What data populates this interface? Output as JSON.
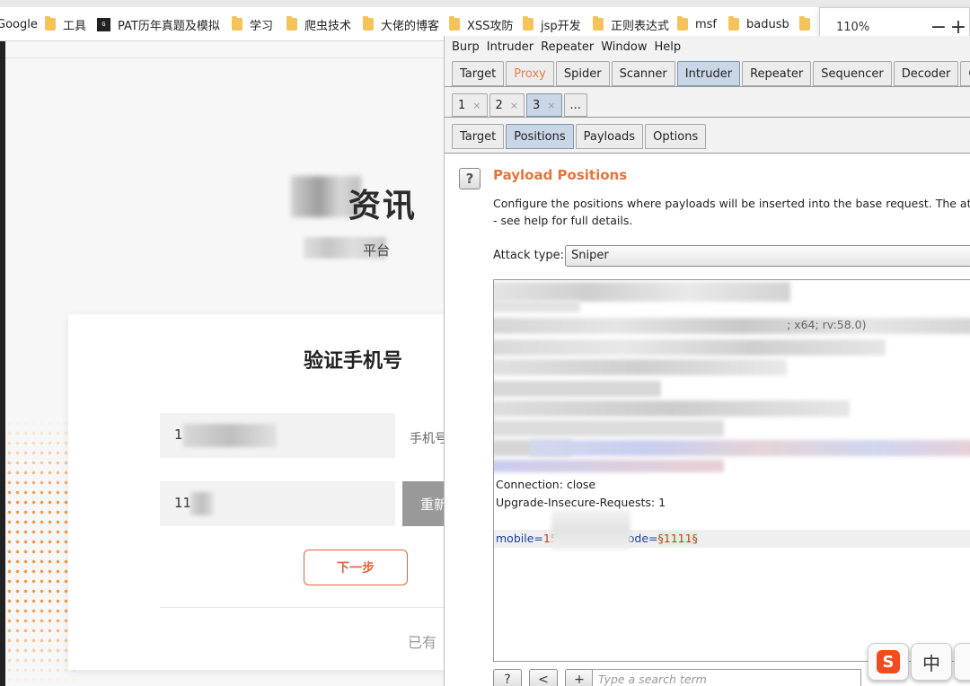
{
  "bookmarks": [
    {
      "label": "Google",
      "icon": "none"
    },
    {
      "label": "工具",
      "icon": "folder-icon"
    },
    {
      "label": "PAT历年真题及模拟",
      "icon": "pat-icon"
    },
    {
      "label": "学习",
      "icon": "folder-icon"
    },
    {
      "label": "爬虫技术",
      "icon": "folder-icon"
    },
    {
      "label": "大佬的博客",
      "icon": "folder-icon"
    },
    {
      "label": "XSS攻防",
      "icon": "folder-icon"
    },
    {
      "label": "jsp开发",
      "icon": "folder-icon"
    },
    {
      "label": "正则表达式",
      "icon": "folder-icon"
    },
    {
      "label": "msf",
      "icon": "folder-icon"
    },
    {
      "label": "badusb",
      "icon": "folder-icon"
    }
  ],
  "zoom": {
    "value": "110%",
    "minus": "−",
    "plus": "+"
  },
  "website": {
    "brand": "资讯",
    "subtitle": "平台",
    "card": {
      "title": "验证手机号",
      "phone_value": "1",
      "phone_label": "手机号",
      "code_value": "11",
      "resend_label": "重新",
      "next_label": "下一步",
      "footer_text": "已有"
    }
  },
  "burp": {
    "menu": [
      "Burp",
      "Intruder",
      "Repeater",
      "Window",
      "Help"
    ],
    "main_tabs": [
      {
        "label": "Target",
        "state": "normal"
      },
      {
        "label": "Proxy",
        "state": "proxy"
      },
      {
        "label": "Spider",
        "state": "normal"
      },
      {
        "label": "Scanner",
        "state": "normal"
      },
      {
        "label": "Intruder",
        "state": "selected"
      },
      {
        "label": "Repeater",
        "state": "normal"
      },
      {
        "label": "Sequencer",
        "state": "normal"
      },
      {
        "label": "Decoder",
        "state": "normal"
      },
      {
        "label": "Comparer",
        "state": "normal"
      }
    ],
    "attack_tabs": [
      {
        "label": "1",
        "close": "×",
        "state": "normal"
      },
      {
        "label": "2",
        "close": "×",
        "state": "normal"
      },
      {
        "label": "3",
        "close": "×",
        "state": "selected"
      },
      {
        "label": "...",
        "close": "",
        "state": "normal"
      }
    ],
    "sub_tabs": [
      {
        "label": "Target",
        "state": "normal"
      },
      {
        "label": "Positions",
        "state": "selected"
      },
      {
        "label": "Payloads",
        "state": "normal"
      },
      {
        "label": "Options",
        "state": "normal"
      }
    ],
    "help_label": "?",
    "heading": "Payload Positions",
    "description_line1": "Configure the positions where payloads will be inserted into the base request. The attack t",
    "description_line2": "- see help for full details.",
    "attack_type_label": "Attack type:",
    "attack_type_value": "Sniper",
    "request": {
      "partial_text": "; x64; rv:58.0)",
      "connection": "Connection: close",
      "upgrade": "Upgrade-Insecure-Requests: 1",
      "param_key1": "mobile=",
      "param_val1": "15",
      "param_key2": "ode=",
      "param_marker": "§1111§"
    },
    "bottom_buttons": [
      "?",
      "<",
      "+",
      ">"
    ],
    "search_placeholder": "Type a search term"
  },
  "ime": {
    "sogou": "S",
    "chinese": "中"
  },
  "colors": {
    "accent_orange": "#e8743b",
    "intruder_tab": "#c8d6e6",
    "param_key": "#1b3fa6",
    "param_value": "#c83a20"
  }
}
